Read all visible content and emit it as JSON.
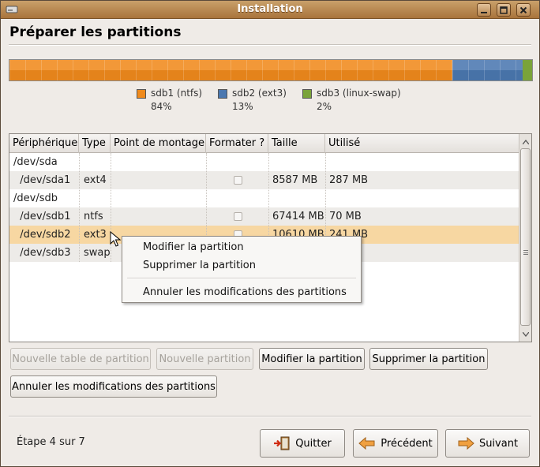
{
  "window": {
    "title": "Installation"
  },
  "page": {
    "title": "Préparer les partitions"
  },
  "partition_bar": {
    "segments": [
      {
        "name": "sdb1 (ntfs)",
        "percent": "84%",
        "color": "#f08a1c"
      },
      {
        "name": "sdb2 (ext3)",
        "percent": "13%",
        "color": "#4b78b0"
      },
      {
        "name": "sdb3 (linux-swap)",
        "percent": "2%",
        "color": "#7aa33a"
      }
    ]
  },
  "table": {
    "headers": [
      "Périphérique",
      "Type",
      "Point de montage",
      "Formater ?",
      "Taille",
      "Utilisé"
    ],
    "rows": [
      {
        "device": "/dev/sda",
        "type": "",
        "mount": "",
        "format": false,
        "size": "",
        "used": ""
      },
      {
        "device": "  /dev/sda1",
        "type": "ext4",
        "mount": "",
        "format": true,
        "size": "8587 MB",
        "used": "287 MB"
      },
      {
        "device": "/dev/sdb",
        "type": "",
        "mount": "",
        "format": false,
        "size": "",
        "used": ""
      },
      {
        "device": "  /dev/sdb1",
        "type": "ntfs",
        "mount": "",
        "format": true,
        "size": "67414 MB",
        "used": "70 MB"
      },
      {
        "device": "  /dev/sdb2",
        "type": "ext3",
        "mount": "",
        "format": true,
        "size": "10610 MB",
        "used": "241 MB"
      },
      {
        "device": "  /dev/sdb3",
        "type": "swap",
        "mount": "",
        "format": false,
        "size": "",
        "used": ""
      }
    ]
  },
  "buttons": {
    "new_table": "Nouvelle table de partition",
    "new_partition": "Nouvelle partition",
    "modify": "Modifier la partition",
    "delete": "Supprimer la partition",
    "revert": "Annuler les modifications des partitions"
  },
  "context_menu": {
    "items": [
      "Modifier la partition",
      "Supprimer la partition",
      "Annuler les modifications des partitions"
    ]
  },
  "footer": {
    "step": "Étape 4 sur 7",
    "quit": "Quitter",
    "back": "Précédent",
    "forward": "Suivant"
  }
}
